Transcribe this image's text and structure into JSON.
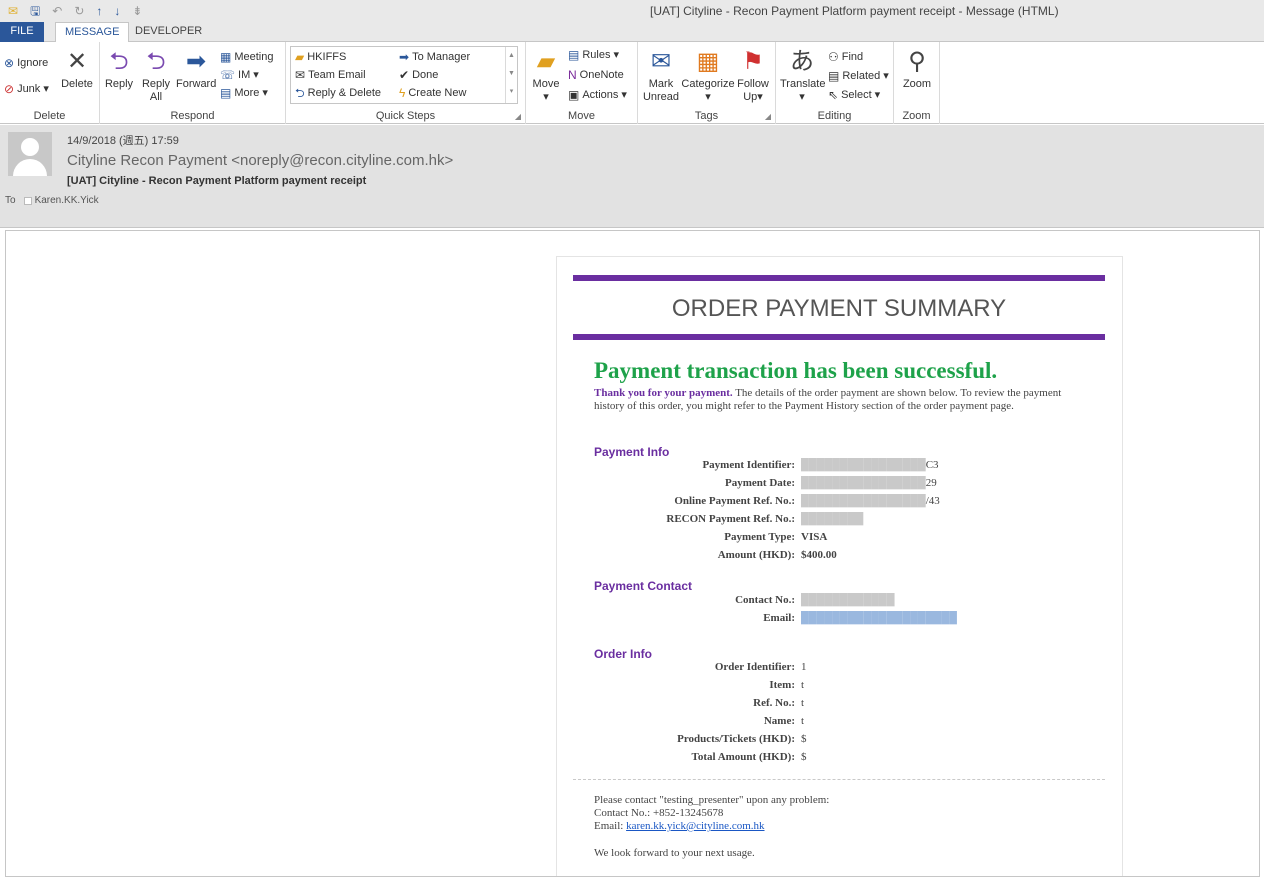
{
  "window": {
    "title": "[UAT] Cityline - Recon Payment Platform payment receipt - Message (HTML)"
  },
  "tabs": {
    "file": "FILE",
    "message": "MESSAGE",
    "developer": "DEVELOPER"
  },
  "ribbon": {
    "delete_group": {
      "label": "Delete",
      "ignore": "Ignore",
      "junk": "Junk",
      "delete": "Delete"
    },
    "respond_group": {
      "label": "Respond",
      "reply": "Reply",
      "reply_all_1": "Reply",
      "reply_all_2": "All",
      "forward": "Forward",
      "meeting": "Meeting",
      "im": "IM",
      "more": "More"
    },
    "quick_steps": {
      "label": "Quick Steps",
      "items": [
        "HKIFFS",
        "Team Email",
        "Reply & Delete",
        "To Manager",
        "Done",
        "Create New"
      ]
    },
    "move_group": {
      "label": "Move",
      "move": "Move",
      "rules": "Rules",
      "onenote": "OneNote",
      "actions": "Actions"
    },
    "tags_group": {
      "label": "Tags",
      "mark_unread_1": "Mark",
      "mark_unread_2": "Unread",
      "categorize": "Categorize",
      "follow_up_1": "Follow",
      "follow_up_2": "Up"
    },
    "editing_group": {
      "label": "Editing",
      "translate": "Translate",
      "find": "Find",
      "related": "Related",
      "select": "Select"
    },
    "zoom_group": {
      "label": "Zoom",
      "zoom": "Zoom"
    }
  },
  "header": {
    "date": "14/9/2018 (週五) 17:59",
    "from": "Cityline Recon Payment <noreply@recon.cityline.com.hk>",
    "subject": "[UAT] Cityline - Recon Payment Platform payment receipt",
    "to_label": "To",
    "to_value": "Karen.KK.Yick"
  },
  "email": {
    "title": "ORDER PAYMENT SUMMARY",
    "success": "Payment transaction has been successful.",
    "intro_bold": "Thank you for your payment.",
    "intro_rest": " The details of the order payment are shown below. To review the payment history of this order, you might refer to the Payment History section of the order payment page.",
    "payment_info": {
      "heading": "Payment Info",
      "rows": [
        {
          "label": "Payment Identifier:",
          "value": "C3"
        },
        {
          "label": "Payment Date:",
          "value": "29"
        },
        {
          "label": "Online Payment Ref. No.:",
          "value": "/43"
        },
        {
          "label": "RECON Payment Ref. No.:",
          "value": ""
        },
        {
          "label": "Payment Type:",
          "value": "VISA"
        },
        {
          "label": "Amount (HKD):",
          "value": "$400.00"
        }
      ]
    },
    "payment_contact": {
      "heading": "Payment Contact",
      "rows": [
        {
          "label": "Contact No.:",
          "value": ""
        },
        {
          "label": "Email:",
          "value": ""
        }
      ]
    },
    "order_info": {
      "heading": "Order Info",
      "rows": [
        {
          "label": "Order Identifier:",
          "value": "1"
        },
        {
          "label": "Item:",
          "value": "t"
        },
        {
          "label": "Ref. No.:",
          "value": "t"
        },
        {
          "label": "Name:",
          "value": "t"
        },
        {
          "label": "Products/Tickets (HKD):",
          "value": "$"
        },
        {
          "label": "Total Amount (HKD):",
          "value": "$"
        }
      ]
    },
    "footer": {
      "line1": "Please contact \"testing_presenter\" upon any problem:",
      "line2": "Contact No.: +852-13245678",
      "email_label": "Email: ",
      "email_link": "karen.kk.yick@cityline.com.hk",
      "closing": "We look forward to your next usage."
    }
  }
}
